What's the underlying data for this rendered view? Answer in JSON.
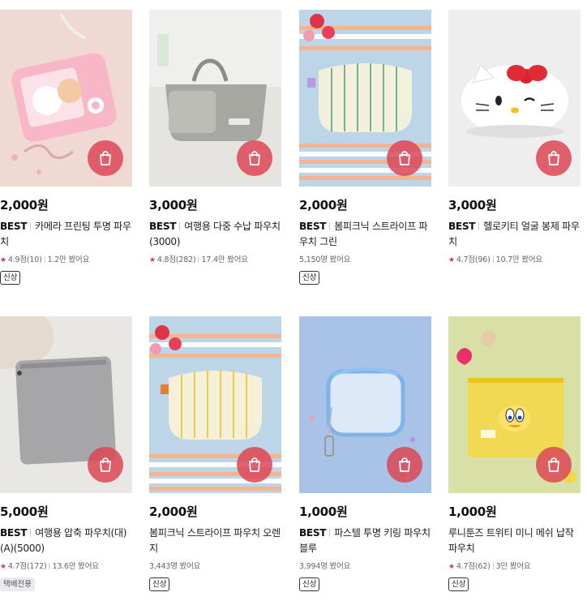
{
  "products": [
    {
      "price": "2,000원",
      "best": "BEST",
      "name": "카메라 프린팅 투명 파우치",
      "rating": "4.9점(10)",
      "views": "1.2만 봤어요",
      "badge": "신상",
      "badge_style": "outline"
    },
    {
      "price": "3,000원",
      "best": "BEST",
      "name": "여행용 다중 수납 파우치(3000)",
      "rating": "4.8점(282)",
      "views": "17.4만 봤어요",
      "badge": "",
      "badge_style": ""
    },
    {
      "price": "2,000원",
      "best": "BEST",
      "name": "봄피크닉 스트라이프 파우치 그린",
      "rating": "",
      "views": "5,150명 봤어요",
      "badge": "신상",
      "badge_style": "outline"
    },
    {
      "price": "3,000원",
      "best": "BEST",
      "name": "헬로키티 얼굴 봉제 파우치",
      "rating": "4.7점(96)",
      "views": "10.7만 봤어요",
      "badge": "",
      "badge_style": ""
    },
    {
      "price": "5,000원",
      "best": "BEST",
      "name": "여행용 압축 파우치(대)(A)(5000)",
      "rating": "4.7점(172)",
      "views": "13.6만 봤어요",
      "badge": "택배전용",
      "badge_style": "gray"
    },
    {
      "price": "2,000원",
      "best": "",
      "name": "봄피크닉 스트라이프 파우치 오렌지",
      "rating": "",
      "views": "3,443명 봤어요",
      "badge": "신상",
      "badge_style": "outline"
    },
    {
      "price": "1,000원",
      "best": "BEST",
      "name": "파스텔 투명 키링 파우치 블루",
      "rating": "",
      "views": "3,994명 봤어요",
      "badge": "신상",
      "badge_style": "outline"
    },
    {
      "price": "1,000원",
      "best": "",
      "name": "루니툰즈 트위티 미니 메쉬 납작 파우치",
      "rating": "4.7점(62)",
      "views": "3만 봤어요",
      "badge": "신상",
      "badge_style": "outline"
    }
  ],
  "icons": {
    "cart": "shopping-bag-icon",
    "star": "star-icon"
  },
  "colors": {
    "cart_button": "#dc4655",
    "star": "#e2334a"
  }
}
